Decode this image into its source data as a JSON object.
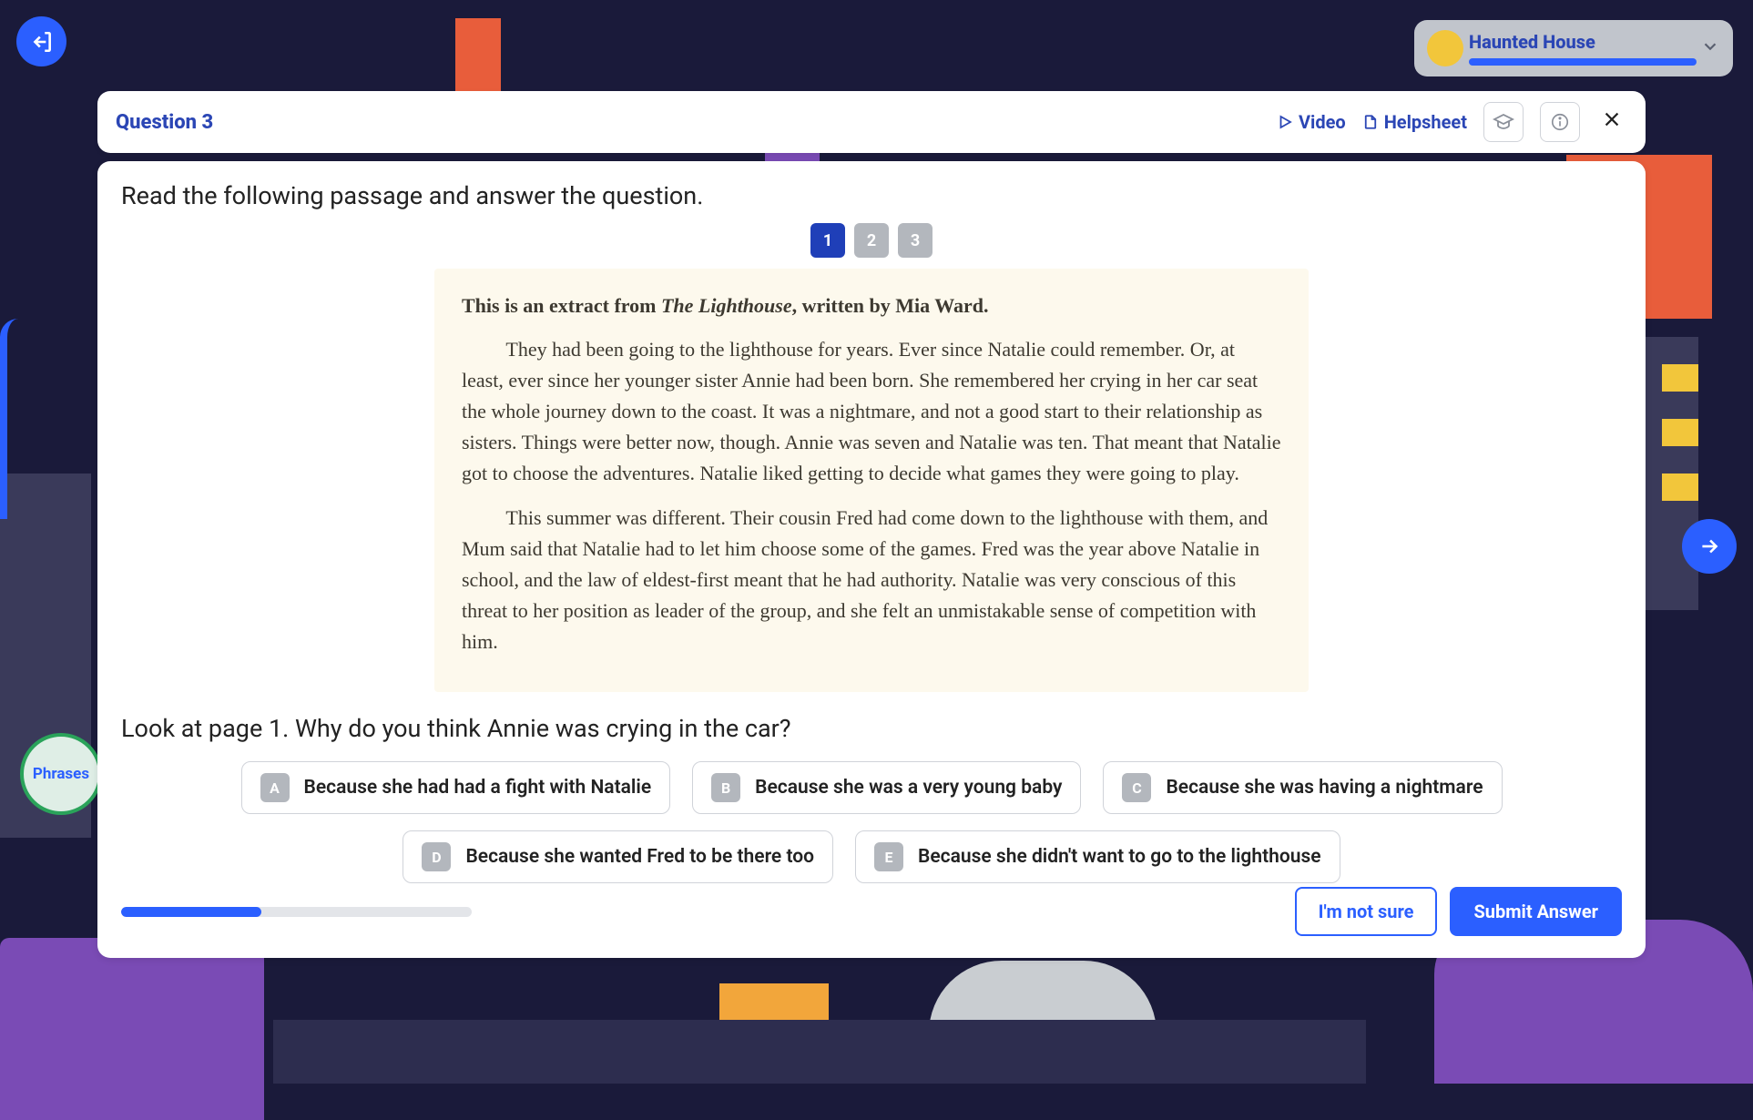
{
  "topbar": {
    "exit_icon": "exit-icon",
    "course_title": "Haunted House",
    "next_icon": "arrow-right-icon",
    "phrases_label": "Phrases"
  },
  "header": {
    "question_label": "Question 3",
    "video_label": "Video",
    "helpsheet_label": "Helpsheet",
    "grad_icon": "graduation-cap-icon",
    "info_icon": "info-icon",
    "close_icon": "close-icon"
  },
  "content": {
    "instruction": "Read the following passage and answer the question.",
    "pages": [
      "1",
      "2",
      "3"
    ],
    "active_page_index": 0,
    "passage": {
      "intro_prefix": "This is an extract from ",
      "intro_title": "The Lighthouse",
      "intro_suffix": ", written by Mia Ward.",
      "para1": "They had been going to the lighthouse for years. Ever since Natalie could remember. Or, at least, ever since her younger sister Annie had been born. She remembered her crying in her car seat the whole journey down to the coast. It was a nightmare, and not a good start to their relationship as sisters. Things were better now, though. Annie was seven and Natalie was ten. That meant that Natalie got to choose the adventures. Natalie liked getting to decide what games they were going to play.",
      "para2": "This summer was different. Their cousin Fred had come down to the lighthouse with them, and Mum said that Natalie had to let him choose some of the games. Fred was the year above Natalie in school, and the law of eldest-first meant that he had authority. Natalie was very conscious of this threat to her position as leader of the group, and she felt an unmistakable sense of competition with him."
    },
    "question": "Look at page 1. Why do you think Annie was crying in the car?",
    "answers": [
      {
        "letter": "A",
        "text": "Because she had had a fight with Natalie"
      },
      {
        "letter": "B",
        "text": "Because she was a very young baby"
      },
      {
        "letter": "C",
        "text": "Because she was having a nightmare"
      },
      {
        "letter": "D",
        "text": "Because she wanted Fred to be there too"
      },
      {
        "letter": "E",
        "text": "Because she didn't want to go to the lighthouse"
      }
    ],
    "progress_percent": 40
  },
  "footer": {
    "not_sure_label": "I'm not sure",
    "submit_label": "Submit Answer"
  }
}
